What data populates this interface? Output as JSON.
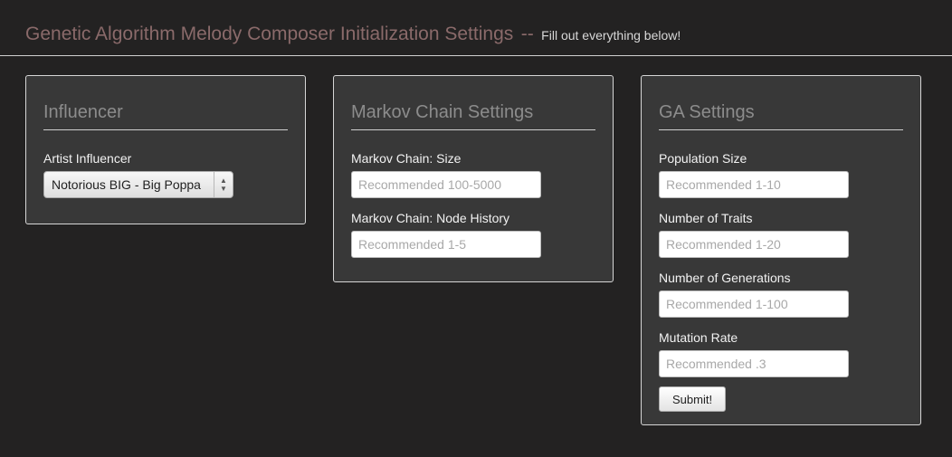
{
  "header": {
    "title": "Genetic Algorithm Melody Composer Initialization Settings",
    "separator": "--",
    "subtitle": "Fill out everything below!"
  },
  "influencer": {
    "title": "Influencer",
    "artist_label": "Artist Influencer",
    "artist_selected": "Notorious BIG - Big Poppa"
  },
  "markov": {
    "title": "Markov Chain Settings",
    "size_label": "Markov Chain: Size",
    "size_placeholder": "Recommended 100-5000",
    "history_label": "Markov Chain: Node History",
    "history_placeholder": "Recommended 1-5"
  },
  "ga": {
    "title": "GA Settings",
    "population_label": "Population Size",
    "population_placeholder": "Recommended 1-10",
    "traits_label": "Number of Traits",
    "traits_placeholder": "Recommended 1-20",
    "generations_label": "Number of Generations",
    "generations_placeholder": "Recommended 1-100",
    "mutation_label": "Mutation Rate",
    "mutation_placeholder": "Recommended .3",
    "submit_label": "Submit!"
  },
  "colors": {
    "background": "#232222",
    "panel": "#383838",
    "title_accent": "#8a6a6a"
  }
}
